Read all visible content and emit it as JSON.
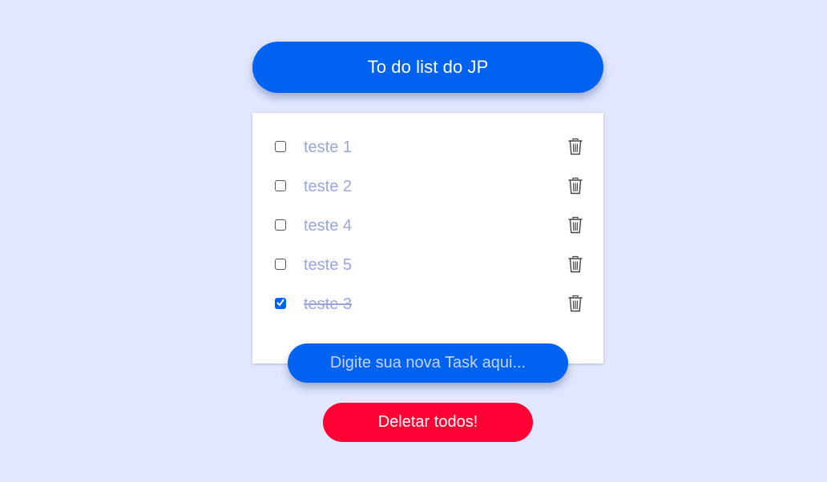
{
  "header": {
    "title": "To do list do JP"
  },
  "tasks": [
    {
      "label": "teste 1",
      "done": false
    },
    {
      "label": "teste 2",
      "done": false
    },
    {
      "label": "teste 4",
      "done": false
    },
    {
      "label": "teste 5",
      "done": false
    },
    {
      "label": "teste 3",
      "done": true
    }
  ],
  "new_task": {
    "placeholder": "Digite sua nova Task aqui..."
  },
  "actions": {
    "delete_all_label": "Deletar todos!"
  },
  "colors": {
    "background": "#e1e7fe",
    "primary": "#0062f0",
    "danger": "#ff0035",
    "task_text": "#9aa4df"
  },
  "icons": {
    "checkbox_checked": "check-icon",
    "delete_task": "trash-icon"
  }
}
